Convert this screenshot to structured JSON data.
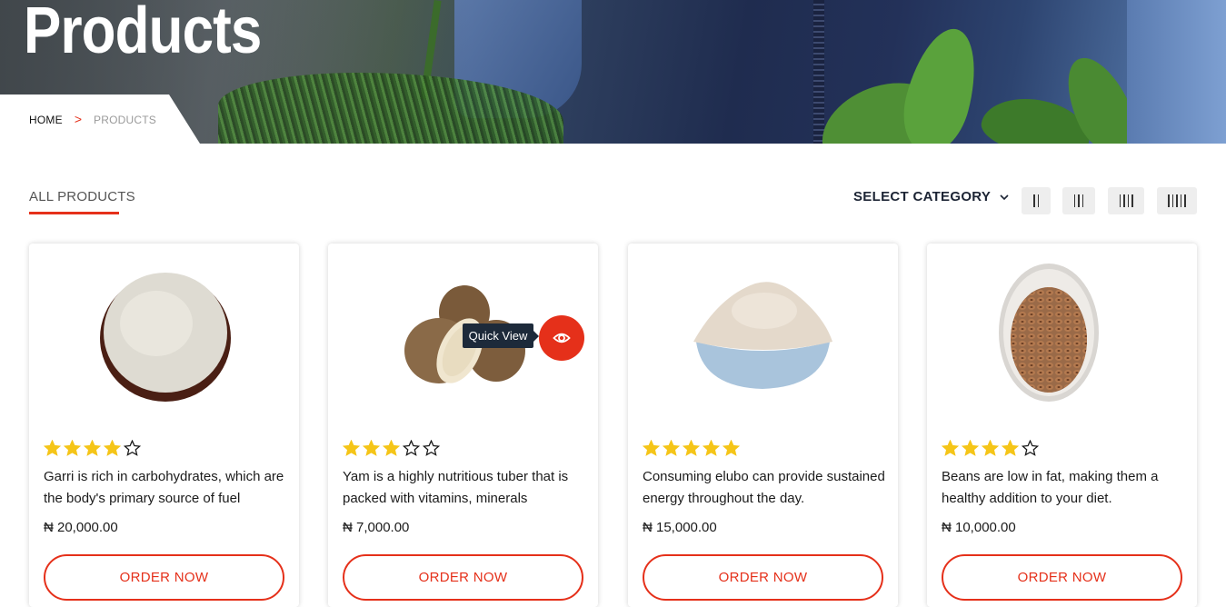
{
  "hero": {
    "title": "Products"
  },
  "breadcrumb": {
    "home": "HOME",
    "separator": ">",
    "current": "PRODUCTS"
  },
  "toolbar": {
    "all_products": "ALL PRODUCTS",
    "select_category": "SELECT CATEGORY",
    "views": [
      "II",
      "III",
      "IIII",
      "IIIII"
    ]
  },
  "quick_view": {
    "label": "Quick View"
  },
  "colors": {
    "accent": "#e5301a",
    "star": "#f5c518",
    "dark": "#1d2a3a"
  },
  "products": [
    {
      "rating": 4,
      "description": "Garri is rich in carbohydrates, which are the body's primary source of fuel",
      "price": "₦ 20,000.00",
      "button": "ORDER NOW",
      "image_icon": "garri-bowl-image"
    },
    {
      "rating": 3,
      "description": "Yam is a highly nutritious tuber that is packed with vitamins, minerals",
      "price": "₦ 7,000.00",
      "button": "ORDER NOW",
      "image_icon": "yam-tubers-image"
    },
    {
      "rating": 5,
      "description": "Consuming elubo can provide sustained energy throughout the day.",
      "price": "₦ 15,000.00",
      "button": "ORDER NOW",
      "image_icon": "elubo-flour-bowl-image"
    },
    {
      "rating": 4,
      "description": "Beans are low in fat, making them a healthy addition to your diet.",
      "price": "₦ 10,000.00",
      "button": "ORDER NOW",
      "image_icon": "beans-bowl-image"
    }
  ]
}
